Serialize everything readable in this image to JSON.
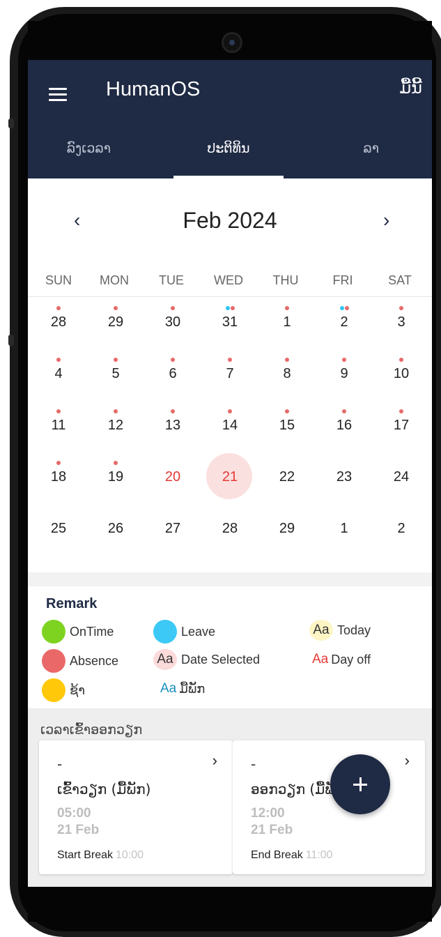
{
  "app": {
    "title": "HumanOS",
    "action_label": "ມື້ນີ້"
  },
  "tabs": [
    {
      "label": "ລົງເວລາ",
      "active": false
    },
    {
      "label": "ປະຕິທິນ",
      "active": true
    },
    {
      "label": "ລາ",
      "active": false
    }
  ],
  "calendar": {
    "month_label": "Feb 2024",
    "prev_icon": "‹",
    "next_icon": "›",
    "weekdays": [
      "SUN",
      "MON",
      "TUE",
      "WED",
      "THU",
      "FRI",
      "SAT"
    ],
    "weeks": [
      [
        "28",
        "29",
        "30",
        "31",
        "1",
        "2",
        "3"
      ],
      [
        "4",
        "5",
        "6",
        "7",
        "8",
        "9",
        "10"
      ],
      [
        "11",
        "12",
        "13",
        "14",
        "15",
        "16",
        "17"
      ],
      [
        "18",
        "19",
        "20",
        "21",
        "22",
        "23",
        "24"
      ],
      [
        "25",
        "26",
        "27",
        "28",
        "29",
        "1",
        "2"
      ]
    ],
    "today": "20",
    "selected": "21",
    "status_colors": {
      "ontime": "#7ed321",
      "leave": "#2ec5f2",
      "absence": "#e76a6a",
      "late": "#ffc90a"
    }
  },
  "remark": {
    "title": "Remark",
    "items": [
      {
        "text": "OnTime",
        "color": "#7ed321"
      },
      {
        "text": "Leave",
        "color": "#3cc9f5"
      },
      {
        "aa": "Aa",
        "text": "Today",
        "bg": "#fdf5c4",
        "aa_color": "#333333"
      },
      {
        "text": "Absence",
        "color": "#ea6868"
      },
      {
        "aa": "Aa",
        "text": "Date Selected",
        "bg": "#fbdada",
        "aa_color": "#333333"
      },
      {
        "aa": "Aa",
        "text": "Day off",
        "bg": "transparent",
        "aa_color": "#e53935"
      },
      {
        "text": "ຊ້າ",
        "color": "#ffc90a"
      },
      {
        "aa": "Aa",
        "text": "ມື້ພັກ",
        "bg": "transparent",
        "aa_color": "#1a8fc0"
      }
    ]
  },
  "work_section": {
    "title": "ເວລາເຂົ້າອອກວຽກ",
    "cards": [
      {
        "status": "-",
        "label": "ເຂົ້າວຽກ (ມື້ພັກ)",
        "time": "05:00",
        "date": "21 Feb",
        "break_label": "Start Break",
        "break_time": "10:00"
      },
      {
        "status": "-",
        "label": "ອອກວຽກ (ມື້ພັກ)",
        "time": "12:00",
        "date": "21 Feb",
        "break_label": "End Break",
        "break_time": "11:00"
      }
    ]
  }
}
